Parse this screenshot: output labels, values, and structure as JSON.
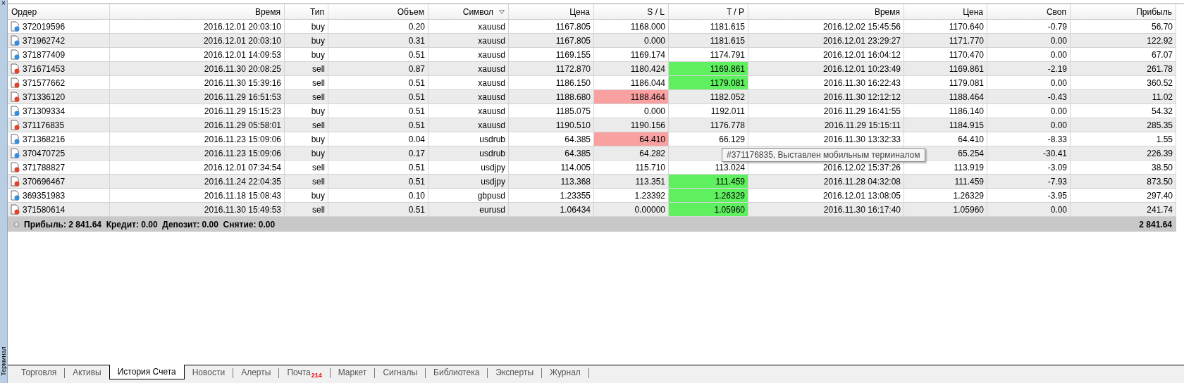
{
  "side_panel": {
    "close": "×",
    "title": "Терминал"
  },
  "table": {
    "columns": [
      {
        "label": "Ордер",
        "sorted": false
      },
      {
        "label": "Время",
        "sorted": false
      },
      {
        "label": "Тип",
        "sorted": false
      },
      {
        "label": "Объем",
        "sorted": false
      },
      {
        "label": "Символ",
        "sorted": true
      },
      {
        "label": "Цена",
        "sorted": false
      },
      {
        "label": "S / L",
        "sorted": false
      },
      {
        "label": "T / P",
        "sorted": false
      },
      {
        "label": "Время",
        "sorted": false
      },
      {
        "label": "Цена",
        "sorted": false
      },
      {
        "label": "Своп",
        "sorted": false
      },
      {
        "label": "Прибыль",
        "sorted": false
      }
    ],
    "rows": [
      {
        "color": "#2f8fe0",
        "order": "372019596",
        "open_time": "2016.12.01 20:03:10",
        "type": "buy",
        "volume": "0.20",
        "symbol": "xauusd",
        "open_price": "1167.805",
        "sl": "1168.000",
        "sl_hit": false,
        "tp": "1181.615",
        "tp_hit": false,
        "close_time": "2016.12.02 15:45:56",
        "close_price": "1170.640",
        "swap": "-0.79",
        "profit": "56.70"
      },
      {
        "color": "#2f8fe0",
        "order": "371962742",
        "open_time": "2016.12.01 20:03:10",
        "type": "buy",
        "volume": "0.31",
        "symbol": "xauusd",
        "open_price": "1167.805",
        "sl": "0.000",
        "sl_hit": false,
        "tp": "1181.615",
        "tp_hit": false,
        "close_time": "2016.12.01 23:29:27",
        "close_price": "1171.770",
        "swap": "0.00",
        "profit": "122.92"
      },
      {
        "color": "#2f8fe0",
        "order": "371877409",
        "open_time": "2016.12.01 14:09:53",
        "type": "buy",
        "volume": "0.51",
        "symbol": "xauusd",
        "open_price": "1169.155",
        "sl": "1169.174",
        "sl_hit": false,
        "tp": "1174.791",
        "tp_hit": false,
        "close_time": "2016.12.01 16:04:12",
        "close_price": "1170.470",
        "swap": "0.00",
        "profit": "67.07"
      },
      {
        "color": "#e0442a",
        "order": "371671453",
        "open_time": "2016.11.30 20:08:25",
        "type": "sell",
        "volume": "0.87",
        "symbol": "xauusd",
        "open_price": "1172.870",
        "sl": "1180.424",
        "sl_hit": false,
        "tp": "1169.861",
        "tp_hit": true,
        "close_time": "2016.12.01 10:23:49",
        "close_price": "1169.861",
        "swap": "-2.19",
        "profit": "261.78"
      },
      {
        "color": "#e0442a",
        "order": "371577662",
        "open_time": "2016.11.30 15:39:16",
        "type": "sell",
        "volume": "0.51",
        "symbol": "xauusd",
        "open_price": "1186.150",
        "sl": "1186.044",
        "sl_hit": false,
        "tp": "1179.081",
        "tp_hit": true,
        "close_time": "2016.11.30 16:22:43",
        "close_price": "1179.081",
        "swap": "0.00",
        "profit": "360.52"
      },
      {
        "color": "#e0442a",
        "order": "371336120",
        "open_time": "2016.11.29 16:51:53",
        "type": "sell",
        "volume": "0.51",
        "symbol": "xauusd",
        "open_price": "1188.680",
        "sl": "1188.464",
        "sl_hit": true,
        "tp": "1182.052",
        "tp_hit": false,
        "close_time": "2016.11.30 12:12:12",
        "close_price": "1188.464",
        "swap": "-0.43",
        "profit": "11.02"
      },
      {
        "color": "#2f8fe0",
        "order": "371309334",
        "open_time": "2016.11.29 15:15:23",
        "type": "buy",
        "volume": "0.51",
        "symbol": "xauusd",
        "open_price": "1185.075",
        "sl": "0.000",
        "sl_hit": false,
        "tp": "1192.011",
        "tp_hit": false,
        "close_time": "2016.11.29 16:41:55",
        "close_price": "1186.140",
        "swap": "0.00",
        "profit": "54.32"
      },
      {
        "color": "#e0442a",
        "order": "371176835",
        "open_time": "2016.11.29 05:58:01",
        "type": "sell",
        "volume": "0.51",
        "symbol": "xauusd",
        "open_price": "1190.510",
        "sl": "1190.156",
        "sl_hit": false,
        "tp": "1176.778",
        "tp_hit": false,
        "close_time": "2016.11.29 15:15:11",
        "close_price": "1184.915",
        "swap": "0.00",
        "profit": "285.35"
      },
      {
        "color": "#2f8fe0",
        "order": "371368216",
        "open_time": "2016.11.23 15:09:06",
        "type": "buy",
        "volume": "0.04",
        "symbol": "usdrub",
        "open_price": "64.385",
        "sl": "64.410",
        "sl_hit": true,
        "tp": "66.129",
        "tp_hit": false,
        "close_time": "2016.11.30 13:32:33",
        "close_price": "64.410",
        "swap": "-8.33",
        "profit": "1.55"
      },
      {
        "color": "#2f8fe0",
        "order": "370470725",
        "open_time": "2016.11.23 15:09:06",
        "type": "buy",
        "volume": "0.17",
        "symbol": "usdrub",
        "open_price": "64.385",
        "sl": "64.282",
        "sl_hit": false,
        "close_price": "65.254",
        "swap": "-30.41",
        "profit": "226.39"
      },
      {
        "color": "#e0442a",
        "order": "371788827",
        "open_time": "2016.12.01 07:34:54",
        "type": "sell",
        "volume": "0.51",
        "symbol": "usdjpy",
        "open_price": "114.005",
        "sl": "115.710",
        "sl_hit": false,
        "tp": "113.024",
        "tp_hit": false,
        "close_time": "2016.12.02 15:37:26",
        "close_price": "113.919",
        "swap": "-3.09",
        "profit": "38.50"
      },
      {
        "color": "#e0442a",
        "order": "370696467",
        "open_time": "2016.11.24 22:04:35",
        "type": "sell",
        "volume": "0.51",
        "symbol": "usdjpy",
        "open_price": "113.368",
        "sl": "113.351",
        "sl_hit": false,
        "tp": "111.459",
        "tp_hit": true,
        "close_time": "2016.11.28 04:32:08",
        "close_price": "111.459",
        "swap": "-7.93",
        "profit": "873.50"
      },
      {
        "color": "#2f8fe0",
        "order": "369351983",
        "open_time": "2016.11.18 15:08:43",
        "type": "buy",
        "volume": "0.10",
        "symbol": "gbpusd",
        "open_price": "1.23355",
        "sl": "1.23392",
        "sl_hit": false,
        "tp": "1.26329",
        "tp_hit": true,
        "close_time": "2016.12.01 13:08:05",
        "close_price": "1.26329",
        "swap": "-3.95",
        "profit": "297.40"
      },
      {
        "color": "#e0442a",
        "order": "371580614",
        "open_time": "2016.11.30 15:49:53",
        "type": "sell",
        "volume": "0.51",
        "symbol": "eurusd",
        "open_price": "1.06434",
        "sl": "0.00000",
        "sl_hit": false,
        "tp": "1.05960",
        "tp_hit": true,
        "close_time": "2016.11.30 16:17:40",
        "close_price": "1.05960",
        "swap": "0.00",
        "profit": "241.74"
      }
    ],
    "summary": {
      "text": "Прибыль: 2 841.64  Кредит: 0.00  Депозит: 0.00  Снятие: 0.00",
      "total": "2 841.64"
    },
    "tooltip": {
      "text": "#371176835, Выставлен мобильным терминалом"
    }
  },
  "tabs": [
    {
      "label": "Торговля",
      "selected": false
    },
    {
      "label": "Активы",
      "selected": false
    },
    {
      "label": "История Счета",
      "selected": true
    },
    {
      "label": "Новости",
      "selected": false
    },
    {
      "label": "Алерты",
      "selected": false
    },
    {
      "label": "Почта",
      "selected": false,
      "badge": "214"
    },
    {
      "label": "Маркет",
      "selected": false
    },
    {
      "label": "Сигналы",
      "selected": false
    },
    {
      "label": "Библиотека",
      "selected": false
    },
    {
      "label": "Эксперты",
      "selected": false
    },
    {
      "label": "Журнал",
      "selected": false
    }
  ]
}
